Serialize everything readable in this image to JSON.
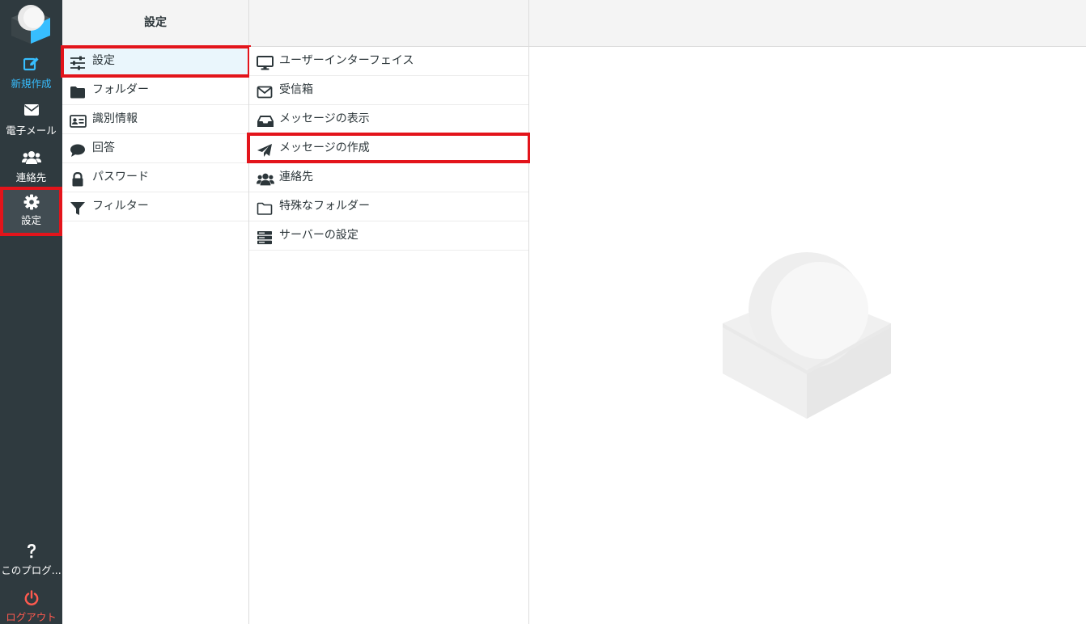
{
  "nav": {
    "items": [
      {
        "label": "新規作成",
        "icon": "compose-icon"
      },
      {
        "label": "電子メール",
        "icon": "envelope-icon"
      },
      {
        "label": "連絡先",
        "icon": "users-icon"
      },
      {
        "label": "設定",
        "icon": "gear-icon"
      }
    ],
    "help": {
      "label": "このプログ...",
      "icon": "question-icon"
    },
    "logout": {
      "label": "ログアウト",
      "icon": "power-icon"
    },
    "colors": {
      "background": "#2f3a3f",
      "compose": "#37beff",
      "logout": "#ff5a4f",
      "highlight": "#e3141b"
    }
  },
  "header": {
    "title": "設定"
  },
  "sections": [
    {
      "label": "設定",
      "icon": "sliders-icon"
    },
    {
      "label": "フォルダー",
      "icon": "folder-icon"
    },
    {
      "label": "識別情報",
      "icon": "id-card-icon"
    },
    {
      "label": "回答",
      "icon": "comment-icon"
    },
    {
      "label": "パスワード",
      "icon": "lock-icon"
    },
    {
      "label": "フィルター",
      "icon": "filter-icon"
    }
  ],
  "preferences": [
    {
      "label": "ユーザーインターフェイス",
      "icon": "monitor-icon"
    },
    {
      "label": "受信箱",
      "icon": "envelope-outline-icon"
    },
    {
      "label": "メッセージの表示",
      "icon": "inbox-icon"
    },
    {
      "label": "メッセージの作成",
      "icon": "paper-plane-icon"
    },
    {
      "label": "連絡先",
      "icon": "users-icon"
    },
    {
      "label": "特殊なフォルダー",
      "icon": "folder-outline-icon"
    },
    {
      "label": "サーバーの設定",
      "icon": "server-icon"
    }
  ]
}
